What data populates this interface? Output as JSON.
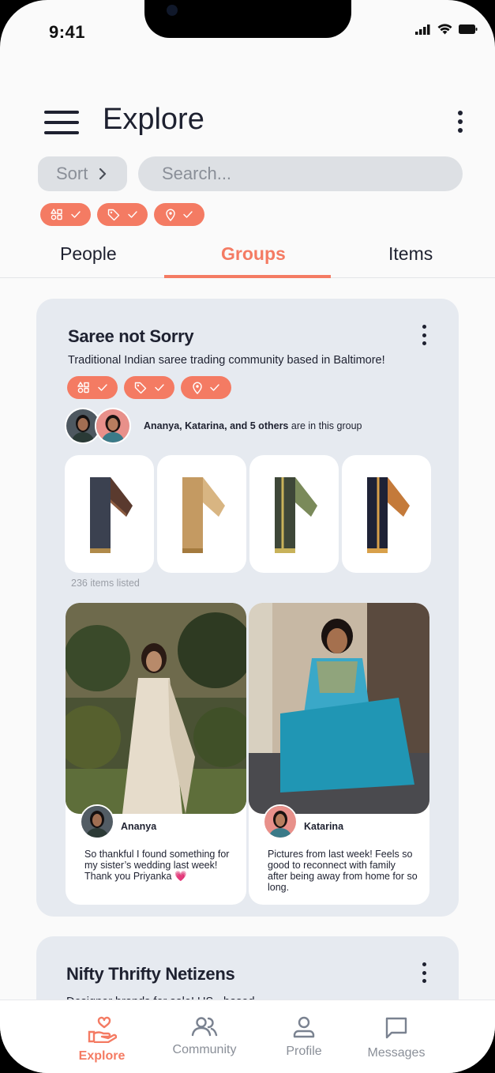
{
  "status_bar": {
    "time": "9:41"
  },
  "header": {
    "title": "Explore"
  },
  "toolbar": {
    "sort_label": "Sort",
    "search_placeholder": "Search...",
    "filter_chips": [
      {
        "icon": "shapes-icon",
        "state": "checked"
      },
      {
        "icon": "tag-icon",
        "state": "checked"
      },
      {
        "icon": "location-pin-icon",
        "state": "checked"
      }
    ]
  },
  "tabs": [
    {
      "label": "People",
      "active": false
    },
    {
      "label": "Groups",
      "active": true
    },
    {
      "label": "Items",
      "active": false
    }
  ],
  "groups": [
    {
      "name": "Saree not Sorry",
      "description": "Traditional Indian saree trading community based in Baltimore!",
      "members_bold": "Ananya, Katarina, and 5 others",
      "members_rest": " are in this group",
      "items_count": "236 items listed",
      "posts": [
        {
          "author": "Ananya",
          "text": "So thankful I found something for my sister’s wedding last week! Thank you Priyanka 💗"
        },
        {
          "author": "Katarina",
          "text": "Pictures from last week! Feels so good to reconnect with family after being away from home for so long."
        }
      ]
    },
    {
      "name": "Nifty Thrifty Netizens",
      "description": "Designer brands for sale! US - based"
    }
  ],
  "bottom_nav": [
    {
      "label": "Explore",
      "icon": "heart-hand-icon",
      "active": true
    },
    {
      "label": "Community",
      "icon": "people-icon",
      "active": false
    },
    {
      "label": "Profile",
      "icon": "person-icon",
      "active": false
    },
    {
      "label": "Messages",
      "icon": "chat-bubble-icon",
      "active": false
    }
  ],
  "colors": {
    "accent": "#f47b63",
    "card_bg": "#e6eaf0",
    "text": "#1e2130"
  }
}
